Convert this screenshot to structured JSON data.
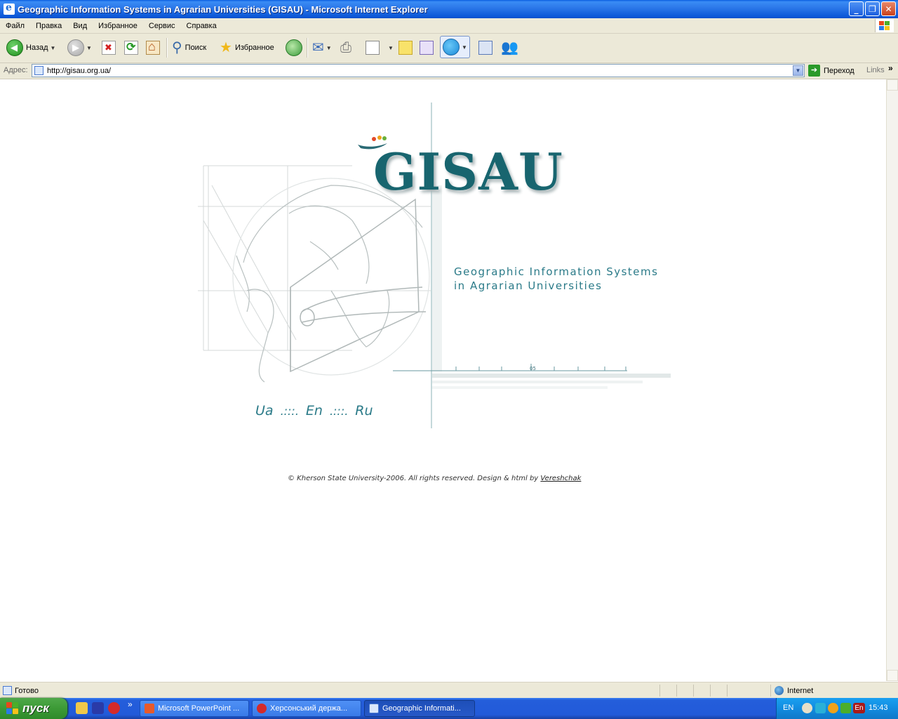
{
  "window": {
    "title": "Geographic Information Systems in Agrarian Universities (GISAU) - Microsoft Internet Explorer",
    "buttons": {
      "minimize": "_",
      "maximize": "❐",
      "close": "✕"
    }
  },
  "menu": {
    "items": [
      "Файл",
      "Правка",
      "Вид",
      "Избранное",
      "Сервис",
      "Справка"
    ]
  },
  "toolbar": {
    "back_label": "Назад",
    "search_label": "Поиск",
    "favorites_label": "Избранное",
    "icons": [
      "back-icon",
      "forward-icon",
      "stop-icon",
      "refresh-icon",
      "home-icon",
      "search-icon",
      "favorites-star-icon",
      "history-icon",
      "mail-icon",
      "print-icon",
      "edit-icon",
      "note-icon",
      "messenger-icon",
      "skype-icon",
      "research-icon",
      "people-icon"
    ]
  },
  "address": {
    "label": "Адрес:",
    "url": "http://gisau.org.ua/",
    "go_label": "Переход",
    "links_label": "Links",
    "links_more": "»"
  },
  "page": {
    "logo": "GISAU",
    "tagline_line1": "Geographic Information Systems",
    "tagline_line2": "in Agrarian Universities",
    "scale_label": "05",
    "languages": [
      "Ua",
      "En",
      "Ru"
    ],
    "lang_separator": ".:::.",
    "copyright_text": "© Kherson State University-2006. All rights reserved. Design & html by",
    "copyright_author": "Vereshchak",
    "colors": {
      "accent": "#18656f",
      "tagline": "#2a7a88"
    }
  },
  "status": {
    "text": "Готово",
    "zone": "Internet"
  },
  "taskbar": {
    "start_label": "пуск",
    "quicklaunch_more": "»",
    "tasks": [
      {
        "label": "Microsoft PowerPoint ...",
        "active": false
      },
      {
        "label": "Херсонський держа...",
        "active": false
      },
      {
        "label": "Geographic Informati...",
        "active": true
      }
    ],
    "tray_lang": "EN",
    "tray_kb": "En",
    "clock": "15:43"
  }
}
